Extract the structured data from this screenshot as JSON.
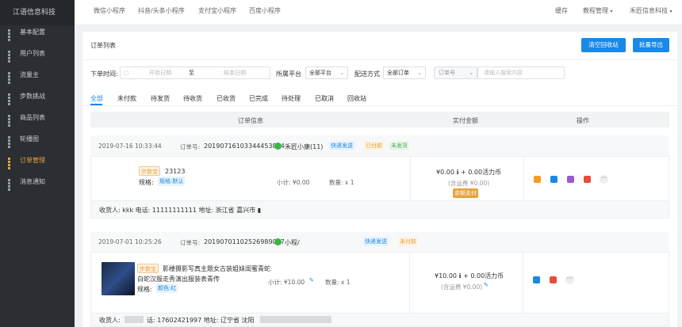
{
  "brand": "江语信息科技",
  "sidebar": {
    "items": [
      {
        "label": "基本配置"
      },
      {
        "label": "用户列表"
      },
      {
        "label": "流量主"
      },
      {
        "label": "步数挑战"
      },
      {
        "label": "商品列表"
      },
      {
        "label": "轮播图"
      },
      {
        "label": "订单管理"
      },
      {
        "label": "消息通知"
      }
    ],
    "active_index": 6
  },
  "topbar": {
    "nav": [
      "微信小程序",
      "抖音/头条小程序",
      "支付宝小程序",
      "百度小程序"
    ],
    "right": [
      "缓存",
      "教程管理",
      "禾匠信息科技"
    ]
  },
  "panel": {
    "title": "订单列表",
    "btn_clear": "清空回收站",
    "btn_export": "批量导出"
  },
  "filters": {
    "time_label": "下单时间:",
    "start_placeholder": "开始日期",
    "to": "至",
    "end_placeholder": "结束日期",
    "platform_label": "所属平台",
    "platform_value": "全部平台",
    "delivery_label": "配送方式",
    "delivery_value": "全部订单",
    "order_select": "订单号",
    "search_placeholder": "请输入搜索内容"
  },
  "tabs": [
    "全部",
    "未付款",
    "待发货",
    "待收货",
    "已收货",
    "已完成",
    "待处理",
    "已取消",
    "回收站"
  ],
  "table_header": {
    "info": "订单信息",
    "amount": "实付金额",
    "ops": "操作"
  },
  "orders": [
    {
      "time": "2019-07-16 10:33:44",
      "order_no_label": "订单号:",
      "order_no": "20190716103344453804",
      "user": "禾匠小康(11)",
      "tags": [
        "快递发送",
        "已付款",
        "未发货"
      ],
      "product_tag": "步数宝",
      "product_title": "23123",
      "spec_label": "规格:",
      "spec": "规格:默认",
      "subtotal": "小计: ¥0.00",
      "qty": "数量: x 1",
      "amount": "¥0.00 ℹ + 0.00活力币",
      "shipping": "(含运费 ¥0.00)",
      "pay_badge": "余额支付",
      "address": "收货人: kkk 电话: 11111111111 地址: 浙江省 嘉兴市 ▮"
    },
    {
      "time": "2019-07-01 10:25:26",
      "order_no_label": "订单号:",
      "order_no": "20190701102526989037",
      "user": "小程/",
      "tags": [
        "快递发送",
        "未付款"
      ],
      "product_tag": "步数宝",
      "product_title_1": "影楼摄影写真主题女古装姐妹闺蜜青蛇",
      "product_title_2": "白蛇汉服走秀演出服装表青传",
      "spec_label": "规格:",
      "spec": "颜色:红",
      "subtotal": "小计: ¥10.00",
      "qty": "数量: x 1",
      "amount": "¥10.00 ℹ + 0.00活力币",
      "shipping": "(含运费 ¥0.00)",
      "address_prefix": "收货人:",
      "address_mid": "话: 17602421997 地址: 辽宁省 沈阳"
    }
  ]
}
